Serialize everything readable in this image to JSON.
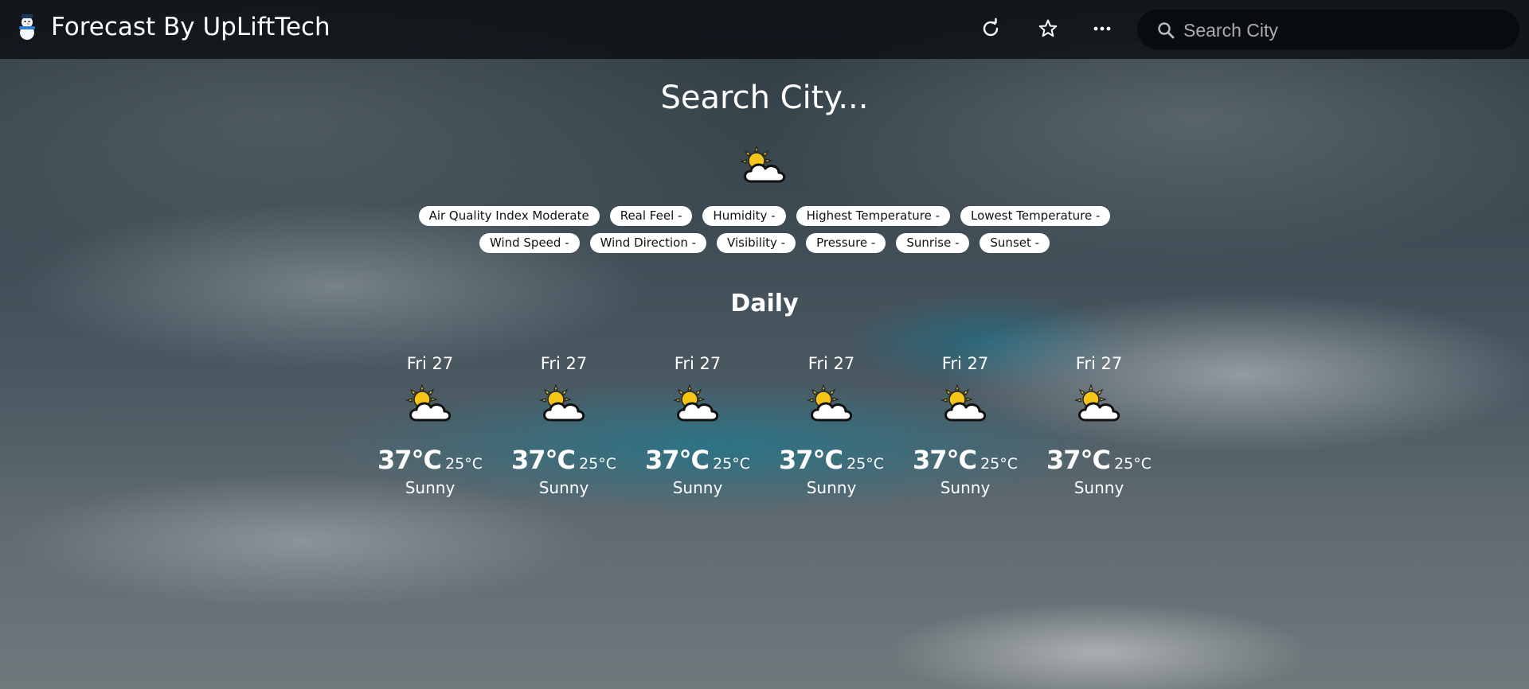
{
  "header": {
    "title": "Forecast By UpLiftTech",
    "logo_icon": "snowman-icon",
    "actions": [
      {
        "name": "refresh",
        "icon": "refresh-icon"
      },
      {
        "name": "favorite",
        "icon": "star-icon"
      },
      {
        "name": "more",
        "icon": "more-horizontal-icon"
      }
    ]
  },
  "search": {
    "placeholder": "Search City",
    "value": ""
  },
  "current": {
    "city": "Search City...",
    "icon": "partly-sunny-icon",
    "details_row1": [
      "Air Quality Index Moderate",
      "Real Feel -",
      "Humidity -",
      "Highest Temperature -",
      "Lowest Temperature -"
    ],
    "details_row2": [
      "Wind Speed -",
      "Wind Direction -",
      "Visibility -",
      "Pressure -",
      "Sunrise -",
      "Sunset -"
    ]
  },
  "daily": {
    "heading": "Daily",
    "days": [
      {
        "date": "Fri 27",
        "high": "37°C",
        "low": "25°C",
        "condition": "Sunny",
        "icon": "partly-sunny-icon"
      },
      {
        "date": "Fri 27",
        "high": "37°C",
        "low": "25°C",
        "condition": "Sunny",
        "icon": "partly-sunny-icon"
      },
      {
        "date": "Fri 27",
        "high": "37°C",
        "low": "25°C",
        "condition": "Sunny",
        "icon": "partly-sunny-icon"
      },
      {
        "date": "Fri 27",
        "high": "37°C",
        "low": "25°C",
        "condition": "Sunny",
        "icon": "partly-sunny-icon"
      },
      {
        "date": "Fri 27",
        "high": "37°C",
        "low": "25°C",
        "condition": "Sunny",
        "icon": "partly-sunny-icon"
      },
      {
        "date": "Fri 27",
        "high": "37°C",
        "low": "25°C",
        "condition": "Sunny",
        "icon": "partly-sunny-icon"
      }
    ]
  },
  "colors": {
    "header_bg": "#0b0f12",
    "chip_bg": "#ffffff",
    "sun": "#f5c518",
    "accent_sky": "#1f7a90"
  }
}
